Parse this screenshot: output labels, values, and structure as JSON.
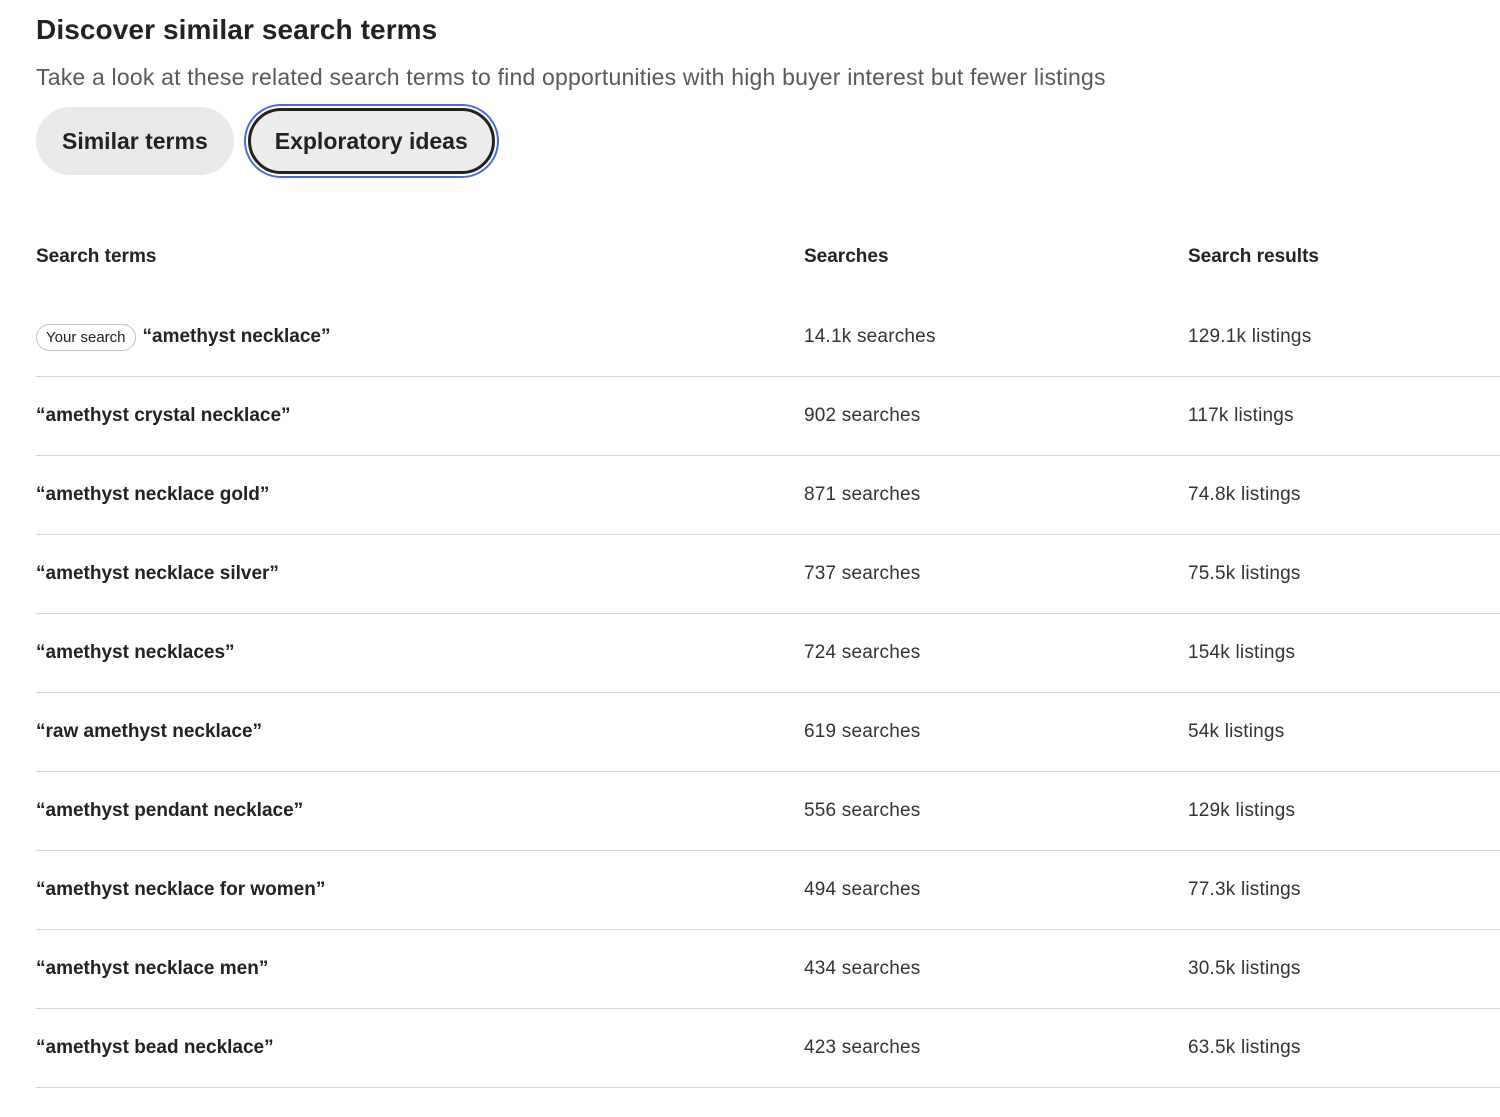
{
  "header": {
    "title": "Discover similar search terms",
    "subtitle": "Take a look at these related search terms to find opportunities with high buyer interest but fewer listings"
  },
  "tabs": [
    {
      "label": "Similar terms",
      "active": false
    },
    {
      "label": "Exploratory ideas",
      "active": true
    }
  ],
  "table": {
    "columns": [
      "Search terms",
      "Searches",
      "Search results"
    ],
    "your_search_badge": "Your search",
    "rows": [
      {
        "term": "“amethyst necklace”",
        "searches": "14.1k searches",
        "results": "129.1k listings",
        "is_your_search": true
      },
      {
        "term": "“amethyst crystal necklace”",
        "searches": "902 searches",
        "results": "117k listings"
      },
      {
        "term": "“amethyst necklace gold”",
        "searches": "871 searches",
        "results": "74.8k listings"
      },
      {
        "term": "“amethyst necklace silver”",
        "searches": "737 searches",
        "results": "75.5k listings"
      },
      {
        "term": "“amethyst necklaces”",
        "searches": "724 searches",
        "results": "154k listings"
      },
      {
        "term": "“raw amethyst necklace”",
        "searches": "619 searches",
        "results": "54k listings"
      },
      {
        "term": "“amethyst pendant necklace”",
        "searches": "556 searches",
        "results": "129k listings"
      },
      {
        "term": "“amethyst necklace for women”",
        "searches": "494 searches",
        "results": "77.3k listings"
      },
      {
        "term": "“amethyst necklace men”",
        "searches": "434 searches",
        "results": "30.5k listings"
      },
      {
        "term": "“amethyst bead necklace”",
        "searches": "423 searches",
        "results": "63.5k listings"
      }
    ]
  },
  "colors": {
    "focus_ring": "#4d6bd8",
    "tab_bg": "#e9e9e9",
    "divider": "#d6d6d6"
  }
}
